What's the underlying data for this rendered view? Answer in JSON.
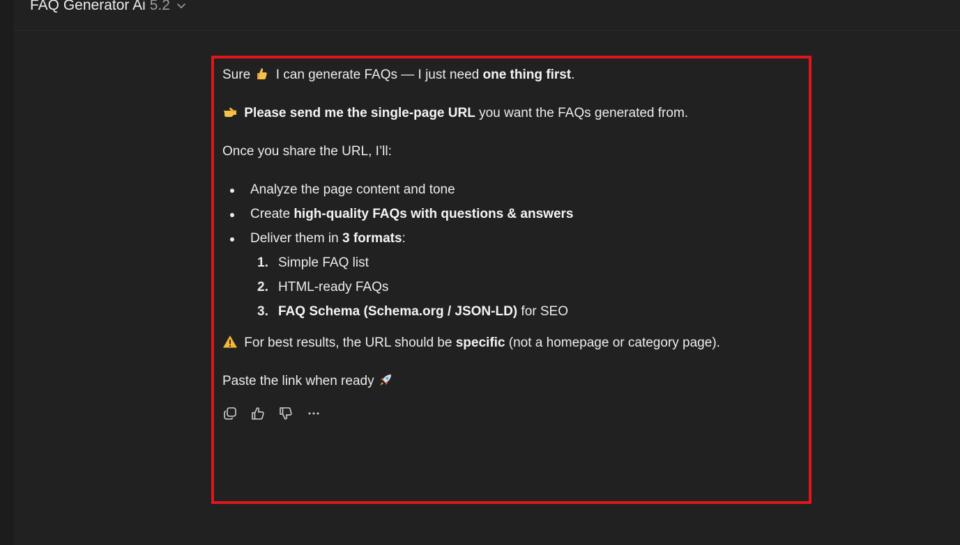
{
  "header": {
    "model_name": "FAQ Generator Ai",
    "model_version": "5.2"
  },
  "message": {
    "intro_pre": "Sure",
    "intro_mid": "I can generate FAQs — I just need",
    "intro_bold": "one thing first",
    "intro_end": ".",
    "request_bold": "Please send me the single-page URL",
    "request_rest": "you want the FAQs generated from.",
    "once_line": "Once you share the URL, I’ll:",
    "bullets": {
      "b1": "Analyze the page content and tone",
      "b2_pre": "Create",
      "b2_bold": "high-quality FAQs with questions & answers",
      "b3_pre": "Deliver them in",
      "b3_bold": "3 formats",
      "b3_end": ":"
    },
    "formats": {
      "f1_num": "1.",
      "f1": "Simple FAQ list",
      "f2_num": "2.",
      "f2": "HTML-ready FAQs",
      "f3_num": "3.",
      "f3_bold": "FAQ Schema (Schema.org / JSON-LD)",
      "f3_rest": "for SEO"
    },
    "warning_pre": "For best results, the URL should be",
    "warning_bold": "specific",
    "warning_rest": "(not a homepage or category page).",
    "closing": "Paste the link when ready"
  },
  "icons": {
    "thumbs_emoji": "thumbs-up-emoji",
    "point_emoji": "pointing-right-emoji",
    "warning_emoji": "warning-emoji",
    "rocket_emoji": "rocket-emoji",
    "copy": "copy-icon",
    "like": "thumbs-up-icon",
    "dislike": "thumbs-down-icon",
    "more": "more-icon"
  },
  "colors": {
    "background": "#212121",
    "highlight": "#e0161b",
    "text": "#ececec"
  }
}
